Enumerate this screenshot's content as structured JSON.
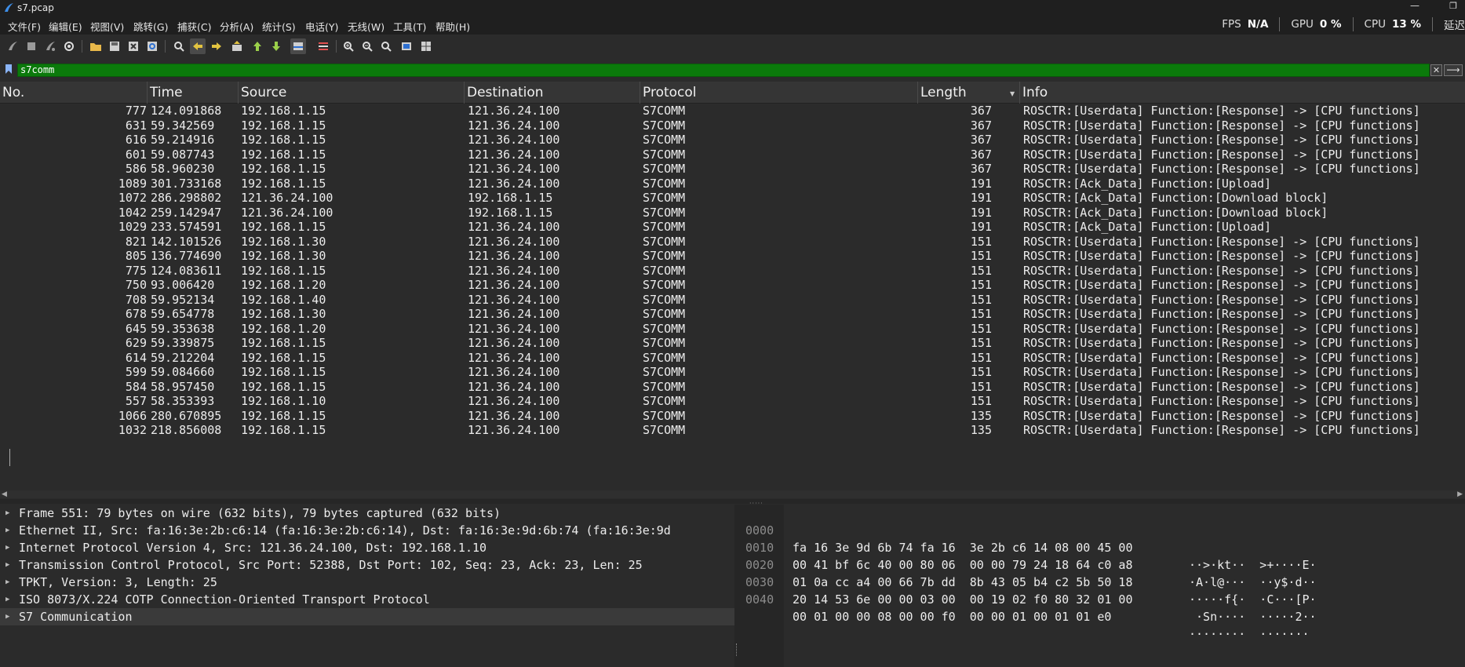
{
  "window": {
    "title": "s7.pcap"
  },
  "menu": [
    "文件(F)",
    "编辑(E)",
    "视图(V)",
    "跳转(G)",
    "捕获(C)",
    "分析(A)",
    "统计(S)",
    "电话(Y)",
    "无线(W)",
    "工具(T)",
    "帮助(H)"
  ],
  "perf": {
    "fps_label": "FPS",
    "fps_value": "N/A",
    "gpu_label": "GPU",
    "gpu_value": "0 %",
    "cpu_label": "CPU",
    "cpu_value": "13 %",
    "extra_label": "延迟"
  },
  "toolbar_icons": [
    "start-capture-icon",
    "stop-capture-icon",
    "restart-capture-icon",
    "capture-options-icon",
    "open-file-icon",
    "save-file-icon",
    "close-file-icon",
    "reload-file-icon",
    "find-packet-icon",
    "go-back-icon",
    "go-forward-icon",
    "go-to-packet-icon",
    "go-first-icon",
    "go-last-icon",
    "auto-scroll-icon",
    "colorize-icon",
    "zoom-in-icon",
    "zoom-out-icon",
    "zoom-reset-icon",
    "resize-columns-icon",
    "layout-icon"
  ],
  "filter": {
    "value": "s7comm"
  },
  "columns": {
    "no": "No.",
    "time": "Time",
    "source": "Source",
    "destination": "Destination",
    "protocol": "Protocol",
    "length": "Length",
    "info": "Info"
  },
  "packets": [
    {
      "no": "777",
      "time": "124.091868",
      "src": "192.168.1.15",
      "dst": "121.36.24.100",
      "proto": "S7COMM",
      "len": "367",
      "info": "ROSCTR:[Userdata] Function:[Response] -> [CPU functions]"
    },
    {
      "no": "631",
      "time": "59.342569",
      "src": "192.168.1.15",
      "dst": "121.36.24.100",
      "proto": "S7COMM",
      "len": "367",
      "info": "ROSCTR:[Userdata] Function:[Response] -> [CPU functions]"
    },
    {
      "no": "616",
      "time": "59.214916",
      "src": "192.168.1.15",
      "dst": "121.36.24.100",
      "proto": "S7COMM",
      "len": "367",
      "info": "ROSCTR:[Userdata] Function:[Response] -> [CPU functions]"
    },
    {
      "no": "601",
      "time": "59.087743",
      "src": "192.168.1.15",
      "dst": "121.36.24.100",
      "proto": "S7COMM",
      "len": "367",
      "info": "ROSCTR:[Userdata] Function:[Response] -> [CPU functions]"
    },
    {
      "no": "586",
      "time": "58.960230",
      "src": "192.168.1.15",
      "dst": "121.36.24.100",
      "proto": "S7COMM",
      "len": "367",
      "info": "ROSCTR:[Userdata] Function:[Response] -> [CPU functions]"
    },
    {
      "no": "1089",
      "time": "301.733168",
      "src": "192.168.1.15",
      "dst": "121.36.24.100",
      "proto": "S7COMM",
      "len": "191",
      "info": "ROSCTR:[Ack_Data] Function:[Upload]"
    },
    {
      "no": "1072",
      "time": "286.298802",
      "src": "121.36.24.100",
      "dst": "192.168.1.15",
      "proto": "S7COMM",
      "len": "191",
      "info": "ROSCTR:[Ack_Data] Function:[Download block]"
    },
    {
      "no": "1042",
      "time": "259.142947",
      "src": "121.36.24.100",
      "dst": "192.168.1.15",
      "proto": "S7COMM",
      "len": "191",
      "info": "ROSCTR:[Ack_Data] Function:[Download block]"
    },
    {
      "no": "1029",
      "time": "233.574591",
      "src": "192.168.1.15",
      "dst": "121.36.24.100",
      "proto": "S7COMM",
      "len": "191",
      "info": "ROSCTR:[Ack_Data] Function:[Upload]"
    },
    {
      "no": "821",
      "time": "142.101526",
      "src": "192.168.1.30",
      "dst": "121.36.24.100",
      "proto": "S7COMM",
      "len": "151",
      "info": "ROSCTR:[Userdata] Function:[Response] -> [CPU functions]"
    },
    {
      "no": "805",
      "time": "136.774690",
      "src": "192.168.1.30",
      "dst": "121.36.24.100",
      "proto": "S7COMM",
      "len": "151",
      "info": "ROSCTR:[Userdata] Function:[Response] -> [CPU functions]"
    },
    {
      "no": "775",
      "time": "124.083611",
      "src": "192.168.1.15",
      "dst": "121.36.24.100",
      "proto": "S7COMM",
      "len": "151",
      "info": "ROSCTR:[Userdata] Function:[Response] -> [CPU functions]"
    },
    {
      "no": "750",
      "time": "93.006420",
      "src": "192.168.1.20",
      "dst": "121.36.24.100",
      "proto": "S7COMM",
      "len": "151",
      "info": "ROSCTR:[Userdata] Function:[Response] -> [CPU functions]"
    },
    {
      "no": "708",
      "time": "59.952134",
      "src": "192.168.1.40",
      "dst": "121.36.24.100",
      "proto": "S7COMM",
      "len": "151",
      "info": "ROSCTR:[Userdata] Function:[Response] -> [CPU functions]"
    },
    {
      "no": "678",
      "time": "59.654778",
      "src": "192.168.1.30",
      "dst": "121.36.24.100",
      "proto": "S7COMM",
      "len": "151",
      "info": "ROSCTR:[Userdata] Function:[Response] -> [CPU functions]"
    },
    {
      "no": "645",
      "time": "59.353638",
      "src": "192.168.1.20",
      "dst": "121.36.24.100",
      "proto": "S7COMM",
      "len": "151",
      "info": "ROSCTR:[Userdata] Function:[Response] -> [CPU functions]"
    },
    {
      "no": "629",
      "time": "59.339875",
      "src": "192.168.1.15",
      "dst": "121.36.24.100",
      "proto": "S7COMM",
      "len": "151",
      "info": "ROSCTR:[Userdata] Function:[Response] -> [CPU functions]"
    },
    {
      "no": "614",
      "time": "59.212204",
      "src": "192.168.1.15",
      "dst": "121.36.24.100",
      "proto": "S7COMM",
      "len": "151",
      "info": "ROSCTR:[Userdata] Function:[Response] -> [CPU functions]"
    },
    {
      "no": "599",
      "time": "59.084660",
      "src": "192.168.1.15",
      "dst": "121.36.24.100",
      "proto": "S7COMM",
      "len": "151",
      "info": "ROSCTR:[Userdata] Function:[Response] -> [CPU functions]"
    },
    {
      "no": "584",
      "time": "58.957450",
      "src": "192.168.1.15",
      "dst": "121.36.24.100",
      "proto": "S7COMM",
      "len": "151",
      "info": "ROSCTR:[Userdata] Function:[Response] -> [CPU functions]"
    },
    {
      "no": "557",
      "time": "58.353393",
      "src": "192.168.1.10",
      "dst": "121.36.24.100",
      "proto": "S7COMM",
      "len": "151",
      "info": "ROSCTR:[Userdata] Function:[Response] -> [CPU functions]"
    },
    {
      "no": "1066",
      "time": "280.670895",
      "src": "192.168.1.15",
      "dst": "121.36.24.100",
      "proto": "S7COMM",
      "len": "135",
      "info": "ROSCTR:[Userdata] Function:[Response] -> [CPU functions]"
    },
    {
      "no": "1032",
      "time": "218.856008",
      "src": "192.168.1.15",
      "dst": "121.36.24.100",
      "proto": "S7COMM",
      "len": "135",
      "info": "ROSCTR:[Userdata] Function:[Response] -> [CPU functions]"
    }
  ],
  "details": [
    "Frame 551: 79 bytes on wire (632 bits), 79 bytes captured (632 bits)",
    "Ethernet II, Src: fa:16:3e:2b:c6:14 (fa:16:3e:2b:c6:14), Dst: fa:16:3e:9d:6b:74 (fa:16:3e:9d",
    "Internet Protocol Version 4, Src: 121.36.24.100, Dst: 192.168.1.10",
    "Transmission Control Protocol, Src Port: 52388, Dst Port: 102, Seq: 23, Ack: 23, Len: 25",
    "TPKT, Version: 3, Length: 25",
    "ISO 8073/X.224 COTP Connection-Oriented Transport Protocol",
    "S7 Communication"
  ],
  "bytes": [
    {
      "offset": "0000",
      "hex": "fa 16 3e 9d 6b 74 fa 16  3e 2b c6 14 08 00 45 00",
      "ascii": "··>·kt··  >+····E·"
    },
    {
      "offset": "0010",
      "hex": "00 41 bf 6c 40 00 80 06  00 00 79 24 18 64 c0 a8",
      "ascii": "·A·l@···  ··y$·d··"
    },
    {
      "offset": "0020",
      "hex": "01 0a cc a4 00 66 7b dd  8b 43 05 b4 c2 5b 50 18",
      "ascii": "·····f{·  ·C···[P·"
    },
    {
      "offset": "0030",
      "hex": "20 14 53 6e 00 00 03 00  00 19 02 f0 80 32 01 00",
      "ascii": " ·Sn····  ·····2··"
    },
    {
      "offset": "0040",
      "hex": "00 01 00 00 08 00 00 f0  00 00 01 00 01 01 e0",
      "ascii": "········  ·······"
    }
  ],
  "colors": {
    "filter_bg": "#0b7a0b",
    "panel_bg": "#2b2b2b",
    "header_bg": "#353535",
    "text": "#ececec"
  }
}
